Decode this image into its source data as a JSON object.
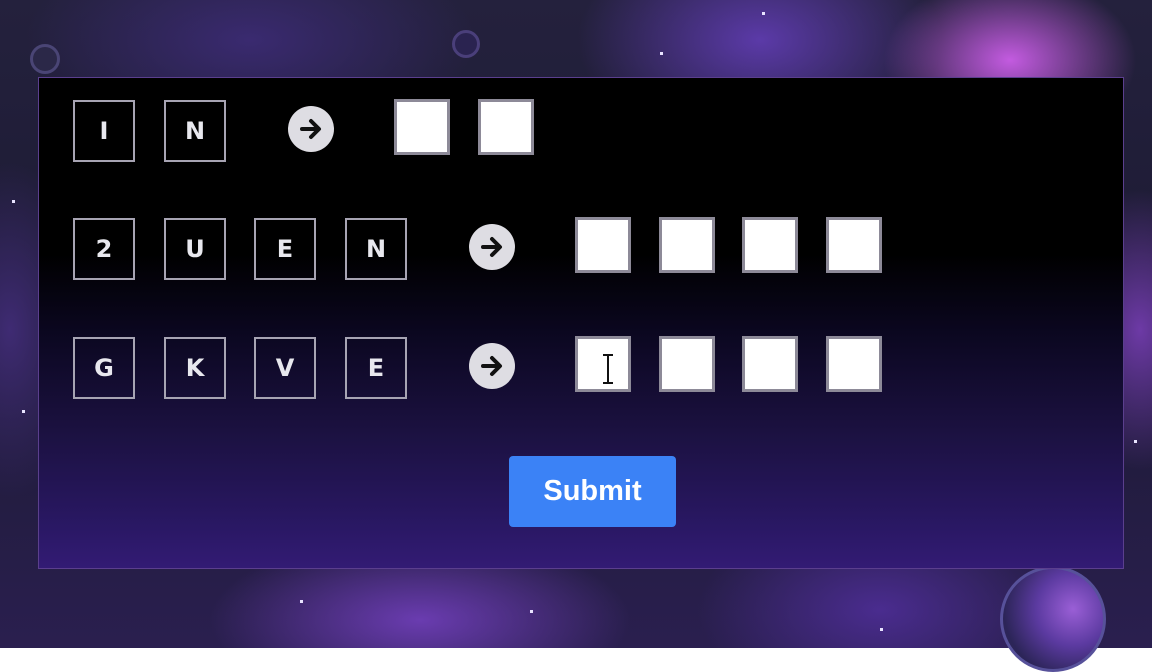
{
  "puzzle": {
    "rows": [
      {
        "letters": [
          "I",
          "N"
        ],
        "arrow_icon": "arrow-right-icon",
        "answer_values": [
          "",
          ""
        ]
      },
      {
        "letters": [
          "2",
          "U",
          "E",
          "N"
        ],
        "arrow_icon": "arrow-right-icon",
        "answer_values": [
          "",
          "",
          "",
          ""
        ]
      },
      {
        "letters": [
          "G",
          "K",
          "V",
          "E"
        ],
        "arrow_icon": "arrow-right-icon",
        "answer_values": [
          "",
          "",
          "",
          ""
        ]
      }
    ]
  },
  "submit": {
    "label": "Submit"
  },
  "colors": {
    "accent": "#3b82f6",
    "tile_border": "#a7a4b3",
    "answer_border": "#8d8a98"
  },
  "cursor_icon": "text-cursor-icon"
}
